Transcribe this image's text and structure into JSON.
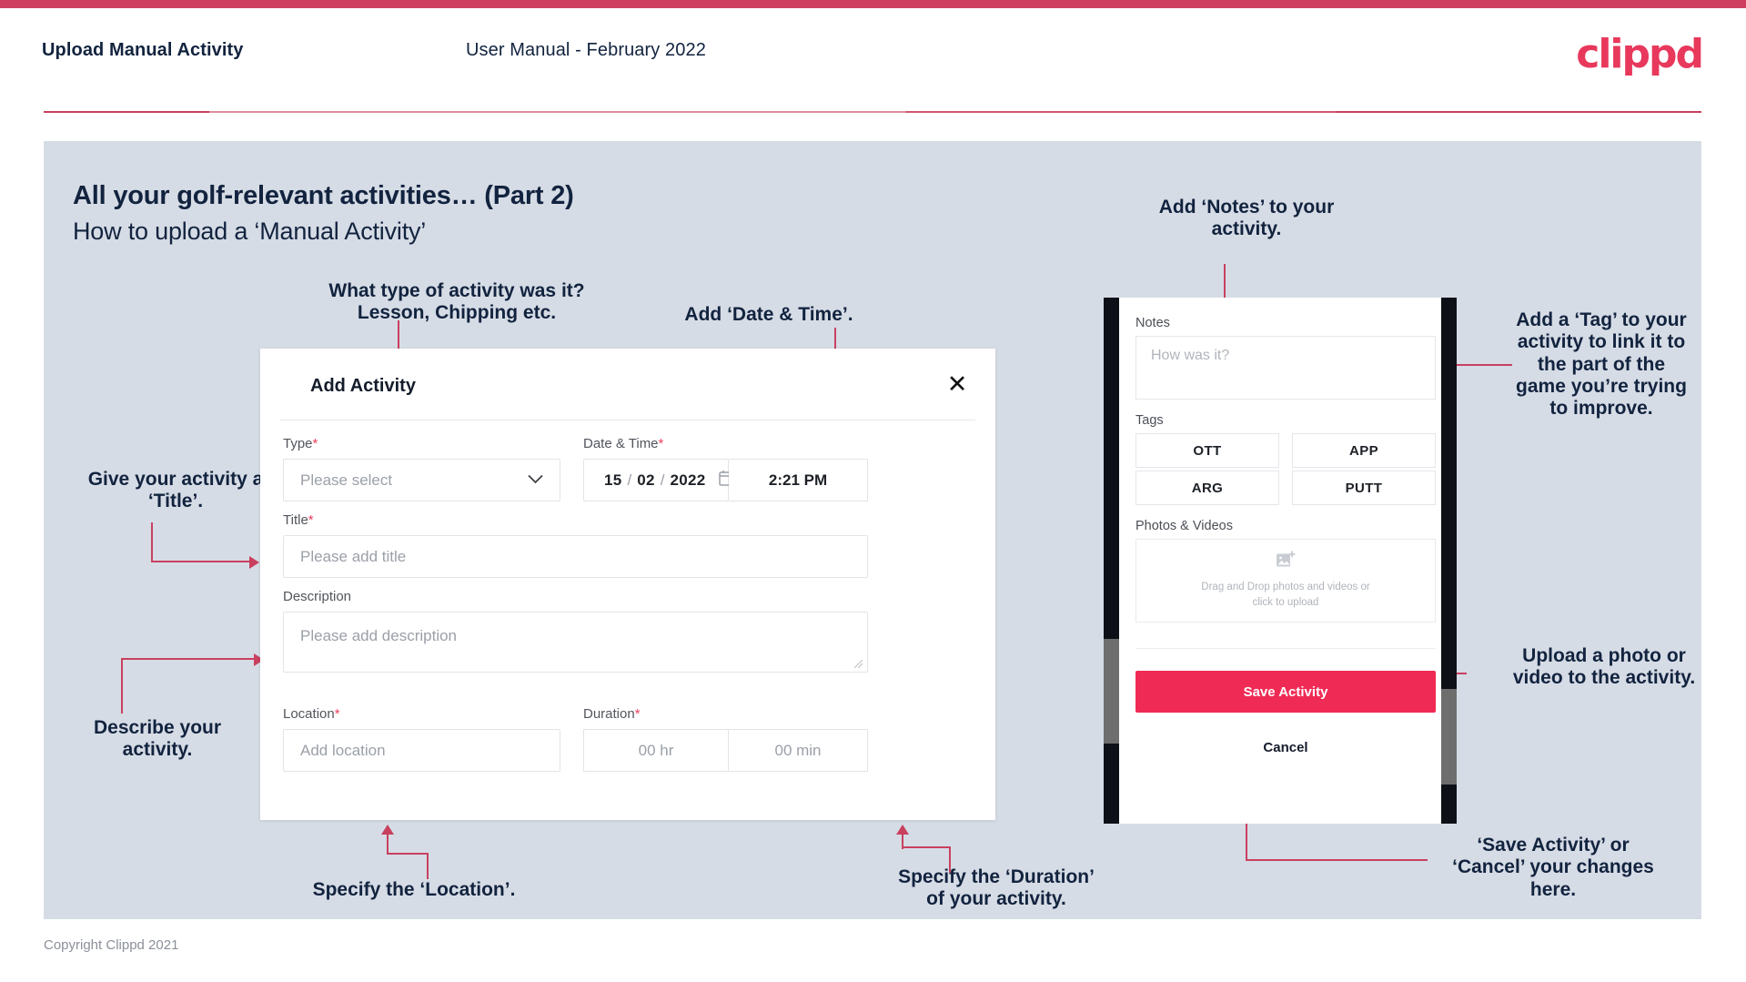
{
  "header": {
    "left_title": "Upload Manual Activity",
    "center_title": "User Manual - February 2022",
    "logo": "clippd"
  },
  "deck": {
    "title": "All your golf-relevant activities… (Part 2)",
    "subtitle": "How to upload a ‘Manual Activity’"
  },
  "annotations": {
    "type": "What type of activity was it?\nLesson, Chipping etc.",
    "datetime": "Add ‘Date & Time’.",
    "title": "Give your activity a\n‘Title’.",
    "description": "Describe your\nactivity.",
    "location": "Specify the ‘Location’.",
    "duration": "Specify the ‘Duration’\nof your activity.",
    "notes": "Add ‘Notes’ to your\nactivity.",
    "tags": "Add a ‘Tag’ to your\nactivity to link it to\nthe part of the\ngame you’re trying\nto improve.",
    "upload": "Upload a photo or\nvideo to the activity.",
    "save_cancel": "‘Save Activity’ or\n‘Cancel’ your changes\nhere."
  },
  "dialog": {
    "title": "Add Activity",
    "close_icon": "close-icon",
    "type": {
      "label": "Type",
      "required": "*",
      "placeholder": "Please select",
      "chevron": "chevron-down-icon"
    },
    "datetime": {
      "label": "Date & Time",
      "required": "*",
      "day": "15",
      "month": "02",
      "year": "2022",
      "sep": "/",
      "time": "2:21 PM",
      "calendar_icon": "calendar-icon"
    },
    "title_field": {
      "label": "Title",
      "required": "*",
      "placeholder": "Please add title"
    },
    "description": {
      "label": "Description",
      "placeholder": "Please add description"
    },
    "location": {
      "label": "Location",
      "required": "*",
      "placeholder": "Add location"
    },
    "duration": {
      "label": "Duration",
      "required": "*",
      "hours_placeholder": "00 hr",
      "minutes_placeholder": "00 min"
    }
  },
  "phone": {
    "notes": {
      "label": "Notes",
      "placeholder": "How was it?"
    },
    "tags": {
      "label": "Tags",
      "items": [
        "OTT",
        "APP",
        "ARG",
        "PUTT"
      ]
    },
    "photos": {
      "label": "Photos & Videos",
      "icon": "add-image-icon",
      "dropzone_text": "Drag and Drop photos and videos or\nclick to upload"
    },
    "save_label": "Save Activity",
    "cancel_label": "Cancel"
  },
  "footer": {
    "copyright": "Copyright Clippd 2021"
  },
  "colors": {
    "accent": "#e8385c",
    "save_button": "#ef2b55",
    "stage_bg": "#d6dce5",
    "text_dark": "#12233f",
    "annotation_line": "#c9405f"
  }
}
